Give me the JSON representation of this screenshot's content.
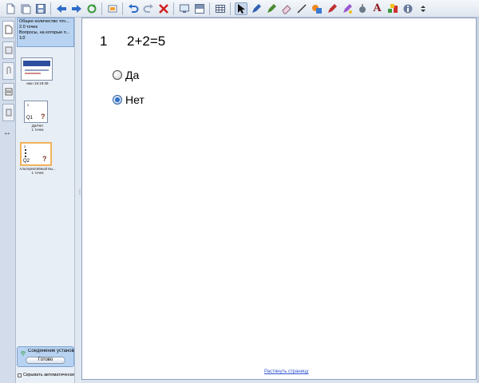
{
  "panel": {
    "info_lines": [
      "Общее количество точ...",
      "2.0 точек",
      "Вопросы, на которые п...",
      "1/2"
    ],
    "thumbs": [
      {
        "caption": "июн 15:19:39"
      },
      {
        "label": "Q1",
        "caption_line1": "Да/Нет",
        "caption_line2": "1 точек"
      },
      {
        "label": "Q2",
        "caption_line1": "Альтернативный вы...",
        "caption_line2": "1 точек"
      }
    ],
    "connection_text": "Соединение установле",
    "ready_button": "Готово",
    "autohide_label": "Скрывать автоматически"
  },
  "question": {
    "number": "1",
    "text": "2+2=5",
    "options": [
      {
        "label": "Да",
        "selected": false
      },
      {
        "label": "Нет",
        "selected": true
      }
    ]
  },
  "stretch_link": "Растянуть страницу",
  "toolbar": {
    "text_tool_glyph": "A",
    "icons": [
      "new-page-icon",
      "open-icon",
      "save-icon",
      "back-icon",
      "forward-icon",
      "refresh-icon",
      "screenshot-icon",
      "undo-icon",
      "redo-icon",
      "delete-icon",
      "display-icon",
      "screen-shade-icon",
      "table-icon",
      "select-icon",
      "pen-icon",
      "creative-pen-icon",
      "eraser-icon",
      "line-icon",
      "shape-icon",
      "magic-pen-icon",
      "fill-icon",
      "highlighter-icon",
      "text-icon",
      "properties-icon",
      "more-icon"
    ]
  },
  "colors": {
    "accent": "#2f6fc7",
    "selected_thumb_border": "#f2b25a",
    "info_panel": "#b8d3f1",
    "link": "#2b4fd0"
  }
}
